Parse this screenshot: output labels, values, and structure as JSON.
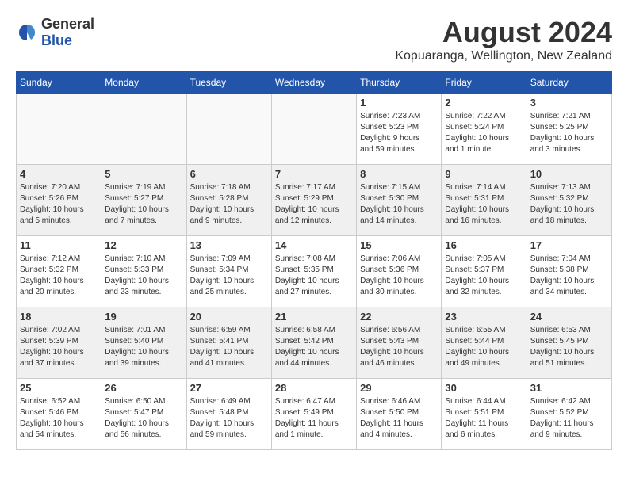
{
  "header": {
    "logo_general": "General",
    "logo_blue": "Blue",
    "month_year": "August 2024",
    "location": "Kopuaranga, Wellington, New Zealand"
  },
  "weekdays": [
    "Sunday",
    "Monday",
    "Tuesday",
    "Wednesday",
    "Thursday",
    "Friday",
    "Saturday"
  ],
  "weeks": [
    [
      {
        "day": "",
        "info": ""
      },
      {
        "day": "",
        "info": ""
      },
      {
        "day": "",
        "info": ""
      },
      {
        "day": "",
        "info": ""
      },
      {
        "day": "1",
        "info": "Sunrise: 7:23 AM\nSunset: 5:23 PM\nDaylight: 9 hours\nand 59 minutes."
      },
      {
        "day": "2",
        "info": "Sunrise: 7:22 AM\nSunset: 5:24 PM\nDaylight: 10 hours\nand 1 minute."
      },
      {
        "day": "3",
        "info": "Sunrise: 7:21 AM\nSunset: 5:25 PM\nDaylight: 10 hours\nand 3 minutes."
      }
    ],
    [
      {
        "day": "4",
        "info": "Sunrise: 7:20 AM\nSunset: 5:26 PM\nDaylight: 10 hours\nand 5 minutes."
      },
      {
        "day": "5",
        "info": "Sunrise: 7:19 AM\nSunset: 5:27 PM\nDaylight: 10 hours\nand 7 minutes."
      },
      {
        "day": "6",
        "info": "Sunrise: 7:18 AM\nSunset: 5:28 PM\nDaylight: 10 hours\nand 9 minutes."
      },
      {
        "day": "7",
        "info": "Sunrise: 7:17 AM\nSunset: 5:29 PM\nDaylight: 10 hours\nand 12 minutes."
      },
      {
        "day": "8",
        "info": "Sunrise: 7:15 AM\nSunset: 5:30 PM\nDaylight: 10 hours\nand 14 minutes."
      },
      {
        "day": "9",
        "info": "Sunrise: 7:14 AM\nSunset: 5:31 PM\nDaylight: 10 hours\nand 16 minutes."
      },
      {
        "day": "10",
        "info": "Sunrise: 7:13 AM\nSunset: 5:32 PM\nDaylight: 10 hours\nand 18 minutes."
      }
    ],
    [
      {
        "day": "11",
        "info": "Sunrise: 7:12 AM\nSunset: 5:32 PM\nDaylight: 10 hours\nand 20 minutes."
      },
      {
        "day": "12",
        "info": "Sunrise: 7:10 AM\nSunset: 5:33 PM\nDaylight: 10 hours\nand 23 minutes."
      },
      {
        "day": "13",
        "info": "Sunrise: 7:09 AM\nSunset: 5:34 PM\nDaylight: 10 hours\nand 25 minutes."
      },
      {
        "day": "14",
        "info": "Sunrise: 7:08 AM\nSunset: 5:35 PM\nDaylight: 10 hours\nand 27 minutes."
      },
      {
        "day": "15",
        "info": "Sunrise: 7:06 AM\nSunset: 5:36 PM\nDaylight: 10 hours\nand 30 minutes."
      },
      {
        "day": "16",
        "info": "Sunrise: 7:05 AM\nSunset: 5:37 PM\nDaylight: 10 hours\nand 32 minutes."
      },
      {
        "day": "17",
        "info": "Sunrise: 7:04 AM\nSunset: 5:38 PM\nDaylight: 10 hours\nand 34 minutes."
      }
    ],
    [
      {
        "day": "18",
        "info": "Sunrise: 7:02 AM\nSunset: 5:39 PM\nDaylight: 10 hours\nand 37 minutes."
      },
      {
        "day": "19",
        "info": "Sunrise: 7:01 AM\nSunset: 5:40 PM\nDaylight: 10 hours\nand 39 minutes."
      },
      {
        "day": "20",
        "info": "Sunrise: 6:59 AM\nSunset: 5:41 PM\nDaylight: 10 hours\nand 41 minutes."
      },
      {
        "day": "21",
        "info": "Sunrise: 6:58 AM\nSunset: 5:42 PM\nDaylight: 10 hours\nand 44 minutes."
      },
      {
        "day": "22",
        "info": "Sunrise: 6:56 AM\nSunset: 5:43 PM\nDaylight: 10 hours\nand 46 minutes."
      },
      {
        "day": "23",
        "info": "Sunrise: 6:55 AM\nSunset: 5:44 PM\nDaylight: 10 hours\nand 49 minutes."
      },
      {
        "day": "24",
        "info": "Sunrise: 6:53 AM\nSunset: 5:45 PM\nDaylight: 10 hours\nand 51 minutes."
      }
    ],
    [
      {
        "day": "25",
        "info": "Sunrise: 6:52 AM\nSunset: 5:46 PM\nDaylight: 10 hours\nand 54 minutes."
      },
      {
        "day": "26",
        "info": "Sunrise: 6:50 AM\nSunset: 5:47 PM\nDaylight: 10 hours\nand 56 minutes."
      },
      {
        "day": "27",
        "info": "Sunrise: 6:49 AM\nSunset: 5:48 PM\nDaylight: 10 hours\nand 59 minutes."
      },
      {
        "day": "28",
        "info": "Sunrise: 6:47 AM\nSunset: 5:49 PM\nDaylight: 11 hours\nand 1 minute."
      },
      {
        "day": "29",
        "info": "Sunrise: 6:46 AM\nSunset: 5:50 PM\nDaylight: 11 hours\nand 4 minutes."
      },
      {
        "day": "30",
        "info": "Sunrise: 6:44 AM\nSunset: 5:51 PM\nDaylight: 11 hours\nand 6 minutes."
      },
      {
        "day": "31",
        "info": "Sunrise: 6:42 AM\nSunset: 5:52 PM\nDaylight: 11 hours\nand 9 minutes."
      }
    ]
  ]
}
